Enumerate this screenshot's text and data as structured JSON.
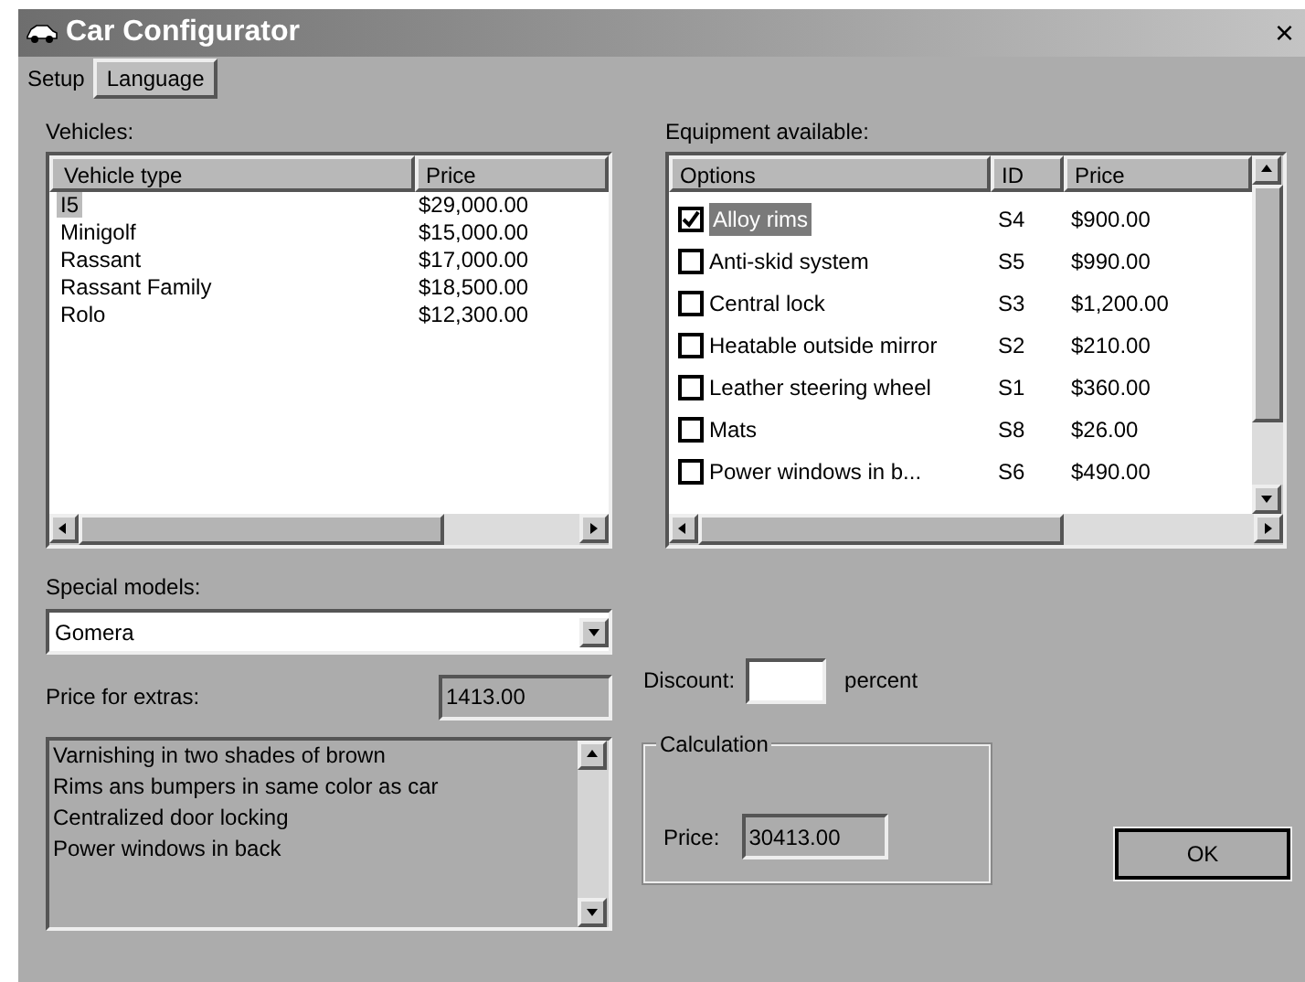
{
  "window": {
    "title": "Car Configurator",
    "close": "×"
  },
  "menu": [
    {
      "label": "Setup",
      "selected": false
    },
    {
      "label": "Language",
      "selected": true
    }
  ],
  "vehicles": {
    "label": "Vehicles:",
    "columns": [
      "Vehicle type",
      "Price"
    ],
    "rows": [
      {
        "type": "I5",
        "price": "$29,000.00",
        "selected": true
      },
      {
        "type": "Minigolf",
        "price": "$15,000.00",
        "selected": false
      },
      {
        "type": "Rassant",
        "price": "$17,000.00",
        "selected": false
      },
      {
        "type": "Rassant Family",
        "price": "$18,500.00",
        "selected": false
      },
      {
        "type": "Rolo",
        "price": "$12,300.00",
        "selected": false
      }
    ]
  },
  "equipment": {
    "label": "Equipment available:",
    "columns": [
      "Options",
      "ID",
      "Price"
    ],
    "rows": [
      {
        "option": "Alloy rims",
        "id": "S4",
        "price": "$900.00",
        "checked": true,
        "selected": true
      },
      {
        "option": "Anti-skid system",
        "id": "S5",
        "price": "$990.00",
        "checked": false,
        "selected": false
      },
      {
        "option": "Central lock",
        "id": "S3",
        "price": "$1,200.00",
        "checked": false,
        "selected": false
      },
      {
        "option": "Heatable outside mirror",
        "id": "S2",
        "price": "$210.00",
        "checked": false,
        "selected": false
      },
      {
        "option": "Leather steering wheel",
        "id": "S1",
        "price": "$360.00",
        "checked": false,
        "selected": false
      },
      {
        "option": "Mats",
        "id": "S8",
        "price": "$26.00",
        "checked": false,
        "selected": false
      },
      {
        "option": "Power windows in b...",
        "id": "S6",
        "price": "$490.00",
        "checked": false,
        "selected": false
      }
    ]
  },
  "special_models": {
    "label": "Special models:",
    "value": "Gomera"
  },
  "price_for_extras": {
    "label": "Price for extras:",
    "value": "1413.00"
  },
  "discount": {
    "label": "Discount:",
    "unit": "percent"
  },
  "description": [
    "Varnishing in two shades of brown",
    "Rims ans bumpers in same color as car",
    "Centralized door locking",
    "Power windows in back"
  ],
  "calculation": {
    "title": "Calculation",
    "label": "Price:",
    "value": "30413.00"
  },
  "ok_button": "OK"
}
